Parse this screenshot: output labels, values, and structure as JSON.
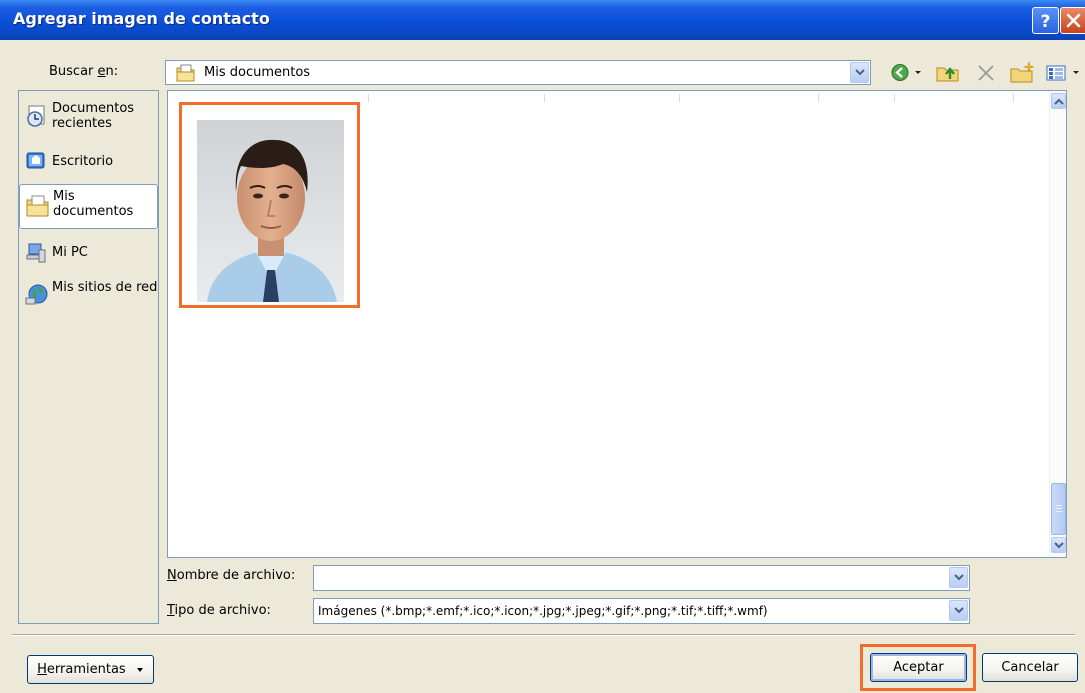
{
  "dialog": {
    "title": "Agregar imagen de contacto",
    "title_bar_colors": {
      "start": "#3d8bf3",
      "end": "#0a3fb2"
    },
    "help_icon": "help-icon",
    "close_icon": "close-icon"
  },
  "lookin": {
    "label_pre": "Buscar ",
    "label_accel": "e",
    "label_post": "n:",
    "value": "Mis documentos"
  },
  "toolbar": {
    "icons": [
      "back-icon",
      "dropdown-icon",
      "up-folder-icon",
      "delete-icon",
      "new-folder-icon",
      "views-icon",
      "views-dropdown-icon"
    ]
  },
  "places": [
    {
      "label": "Documentos recientes",
      "icon": "recent-documents-icon",
      "selected": false
    },
    {
      "label": "Escritorio",
      "icon": "desktop-icon",
      "selected": false
    },
    {
      "label": "Mis documentos",
      "icon": "my-documents-icon",
      "selected": true
    },
    {
      "label": "Mi PC",
      "icon": "my-computer-icon",
      "selected": false
    },
    {
      "label": "Mis sitios de red",
      "icon": "network-places-icon",
      "selected": false
    }
  ],
  "files": [
    {
      "type": "image",
      "description": "contact-photo",
      "selected": true
    }
  ],
  "filename": {
    "accel": "N",
    "label_rest": "ombre de archivo:",
    "value": ""
  },
  "filetype": {
    "accel": "T",
    "label_rest": "ipo de archivo:",
    "value": "Imágenes (*.bmp;*.emf;*.ico;*.icon;*.jpg;*.jpeg;*.gif;*.png;*.tif;*.tiff;*.wmf)"
  },
  "buttons": {
    "tools_accel": "H",
    "tools_rest": "erramientas",
    "ok": "Aceptar",
    "cancel": "Cancelar"
  },
  "colors": {
    "highlight": "#f26d2b",
    "face": "#ece9d8",
    "border": "#7f9db9"
  }
}
